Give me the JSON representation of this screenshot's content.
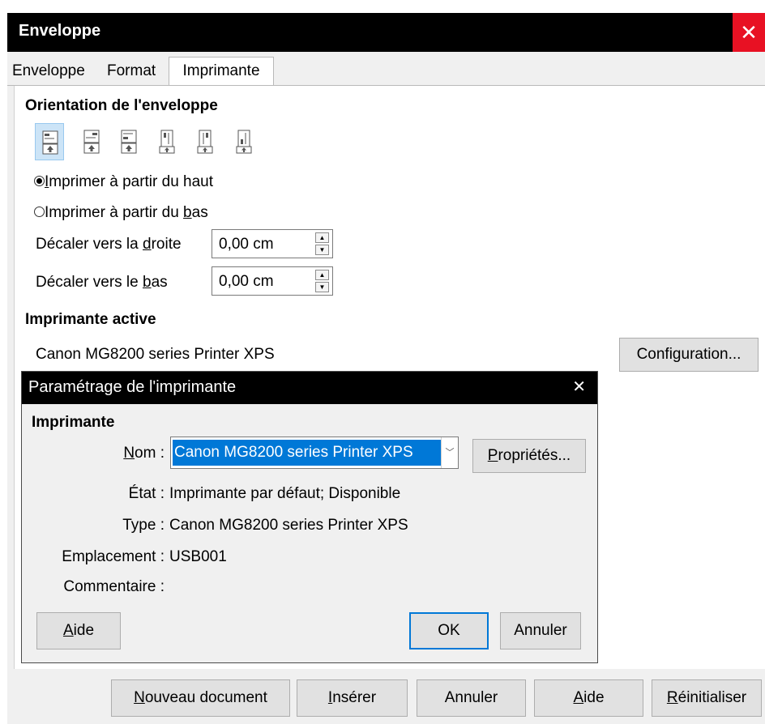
{
  "window": {
    "title": "Enveloppe",
    "close_icon": "close-icon",
    "close_color": "#e81123"
  },
  "tabs": [
    {
      "label": "Enveloppe"
    },
    {
      "label": "Format"
    },
    {
      "label": "Imprimante",
      "active": true
    }
  ],
  "orientation": {
    "heading": "Orientation de l'enveloppe",
    "buttons": [
      "envelope-landscape-icon",
      "envelope-landscape-icon",
      "envelope-landscape-icon",
      "envelope-portrait-icon",
      "envelope-portrait-icon",
      "envelope-portrait-icon"
    ],
    "selected_index": 0
  },
  "print_from": {
    "top": {
      "pre": "",
      "ul": "I",
      "post": "mprimer à partir du haut",
      "checked": true
    },
    "bottom": {
      "pre": "Imprimer à partir du ",
      "ul": "b",
      "post": "as",
      "checked": false
    }
  },
  "shift_right": {
    "pre": "Décaler vers la ",
    "ul": "d",
    "post": "roite",
    "value": "0,00 cm"
  },
  "shift_down": {
    "pre": "Décaler vers le ",
    "ul": "b",
    "post": "as",
    "value": "0,00 cm"
  },
  "active_printer": {
    "heading": "Imprimante active",
    "name": "Canon MG8200 series Printer XPS",
    "config": {
      "pre": "Confi",
      "ul": "g",
      "post": "uration..."
    }
  },
  "printer_setup": {
    "title": "Paramétrage de l'imprimante",
    "close_icon": "close-icon",
    "section": "Imprimante",
    "name_label": {
      "pre": "",
      "ul": "N",
      "post": "om :"
    },
    "name_value": "Canon MG8200 series Printer XPS",
    "properties": {
      "pre": "",
      "ul": "P",
      "post": "ropriétés..."
    },
    "status_label": "État :",
    "status_value": "Imprimante par défaut; Disponible",
    "type_label": "Type :",
    "type_value": "Canon MG8200 series Printer XPS",
    "location_label": "Emplacement :",
    "location_value": "USB001",
    "comment_label": "Commentaire :",
    "help": {
      "pre": "",
      "ul": "A",
      "post": "ide"
    },
    "ok": "OK",
    "cancel": "Annuler"
  },
  "footer": {
    "new_doc": {
      "pre": "",
      "ul": "N",
      "post": "ouveau document"
    },
    "insert": {
      "pre": "",
      "ul": "I",
      "post": "nsérer"
    },
    "cancel": "Annuler",
    "help": {
      "pre": "",
      "ul": "A",
      "post": "ide"
    },
    "reset": {
      "pre": "",
      "ul": "R",
      "post": "éinitialiser"
    }
  }
}
